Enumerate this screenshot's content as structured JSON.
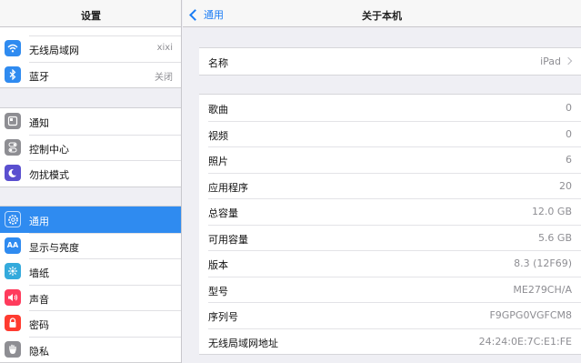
{
  "sidebar": {
    "title": "设置",
    "groups": [
      {
        "items": [
          {
            "label": "无线局域网",
            "value": "xixi",
            "icon": "wifi-icon",
            "color": "#2f8bf0"
          },
          {
            "label": "蓝牙",
            "value": "关闭",
            "icon": "bluetooth-icon",
            "color": "#2f8bf0"
          }
        ]
      },
      {
        "items": [
          {
            "label": "通知",
            "icon": "notifications-icon",
            "color": "#8e8e93"
          },
          {
            "label": "控制中心",
            "icon": "control-center-icon",
            "color": "#8e8e93"
          },
          {
            "label": "勿扰模式",
            "icon": "moon-icon",
            "color": "#5a4fcf"
          }
        ]
      },
      {
        "items": [
          {
            "label": "通用",
            "icon": "gear-icon",
            "color": "#8e8e93",
            "selected": true
          },
          {
            "label": "显示与亮度",
            "icon": "display-icon",
            "color": "#2f8bf0"
          },
          {
            "label": "墙纸",
            "icon": "wallpaper-icon",
            "color": "#34aadc"
          },
          {
            "label": "声音",
            "icon": "sound-icon",
            "color": "#ff3b5c"
          },
          {
            "label": "密码",
            "icon": "lock-icon",
            "color": "#ff3b30"
          },
          {
            "label": "隐私",
            "icon": "hand-icon",
            "color": "#8e8e93"
          }
        ]
      }
    ]
  },
  "header": {
    "back_label": "通用",
    "title": "关于本机"
  },
  "name_row": {
    "label": "名称",
    "value": "iPad"
  },
  "info_rows": [
    {
      "label": "歌曲",
      "value": "0"
    },
    {
      "label": "视频",
      "value": "0"
    },
    {
      "label": "照片",
      "value": "6"
    },
    {
      "label": "应用程序",
      "value": "20"
    },
    {
      "label": "总容量",
      "value": "12.0 GB"
    },
    {
      "label": "可用容量",
      "value": "5.6 GB"
    },
    {
      "label": "版本",
      "value": "8.3 (12F69)"
    },
    {
      "label": "型号",
      "value": "ME279CH/A"
    },
    {
      "label": "序列号",
      "value": "F9GPG0VGFCM8"
    },
    {
      "label": "无线局域网地址",
      "value": "24:24:0E:7C:E1:FE"
    }
  ]
}
